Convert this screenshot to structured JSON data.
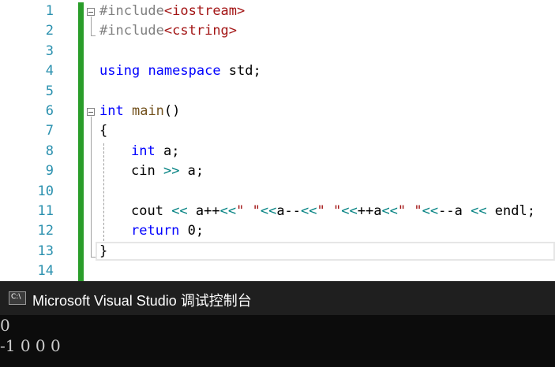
{
  "editor": {
    "line_numbers": [
      "1",
      "2",
      "3",
      "4",
      "5",
      "6",
      "7",
      "8",
      "9",
      "10",
      "11",
      "12",
      "13",
      "14"
    ],
    "lines": {
      "l1": {
        "kw": "#include",
        "lt": "<",
        "name": "iostream",
        "gt": ">"
      },
      "l2": {
        "kw": "#include",
        "lt": "<",
        "name": "cstring",
        "gt": ">"
      },
      "l4": {
        "using": "using",
        "namespace": "namespace",
        "rest": " std;"
      },
      "l6": {
        "int": "int",
        "main": "main",
        "rest": "()"
      },
      "l7": {
        "text": "{"
      },
      "l8": {
        "int": "int",
        "rest": " a;"
      },
      "l9": {
        "cin": "cin ",
        "op": ">>",
        "rest": " a;"
      },
      "l11": {
        "cout": "cout ",
        "op1": "<<",
        "p1": " a++",
        "op2": "<<",
        "s1": "\" \"",
        "op3": "<<",
        "p2": "a--",
        "op4": "<<",
        "s2": "\" \"",
        "op5": "<<",
        "p3": "++a",
        "op6": "<<",
        "s3": "\" \"",
        "op7": "<<",
        "p4": "--a ",
        "op8": "<<",
        "endl": " endl;"
      },
      "l12": {
        "ret": "return",
        "rest": " 0;"
      },
      "l13": {
        "text": "}"
      }
    }
  },
  "console": {
    "title": "Microsoft Visual Studio 调试控制台",
    "icon_label": "C:\\",
    "icon": "console-app-icon",
    "output": [
      "0",
      "-1 0 0 0"
    ]
  },
  "colors": {
    "keyword": "#0000ff",
    "line_number": "#2b91af",
    "string": "#a31515",
    "change_bar": "#2a9d2a",
    "console_bg": "#0c0c0c"
  }
}
